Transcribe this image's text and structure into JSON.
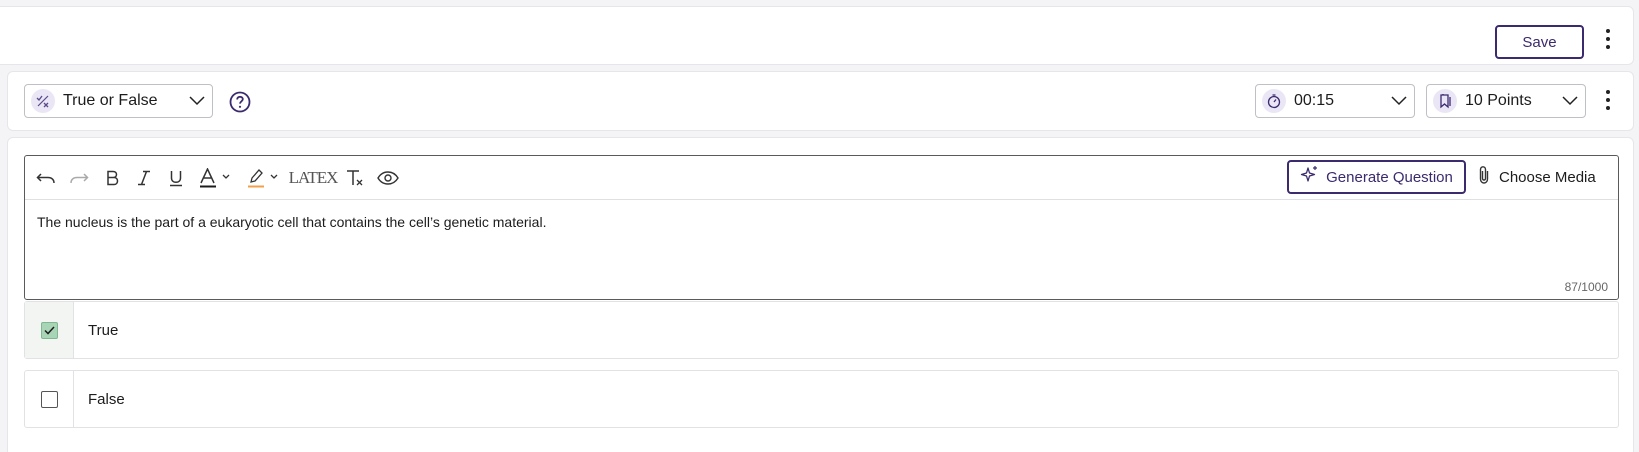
{
  "top_bar": {
    "save_label": "Save"
  },
  "settings": {
    "question_type": "True or False",
    "timer": "00:15",
    "points": "10 Points"
  },
  "toolbar": {
    "latex_label": "LATEX",
    "generate_label": "Generate Question",
    "media_label": "Choose Media"
  },
  "editor": {
    "question_text": "The nucleus is the part of a eukaryotic cell that contains the cell’s genetic material.",
    "char_count": "87/1000"
  },
  "options": [
    {
      "label": "True",
      "checked": true
    },
    {
      "label": "False",
      "checked": false
    }
  ],
  "colors": {
    "accent": "#3b2a6e",
    "badge_bg": "#ebe6f5",
    "checked_fill": "#a8d5b6"
  }
}
